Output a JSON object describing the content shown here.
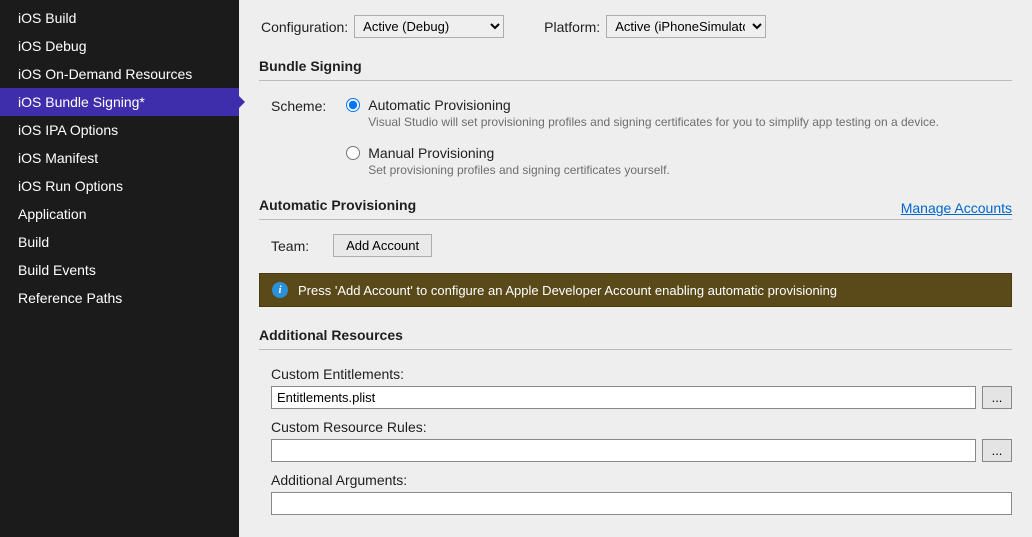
{
  "sidebar": {
    "items": [
      {
        "label": "iOS Build"
      },
      {
        "label": "iOS Debug"
      },
      {
        "label": "iOS On-Demand Resources"
      },
      {
        "label": "iOS Bundle Signing*"
      },
      {
        "label": "iOS IPA Options"
      },
      {
        "label": "iOS Manifest"
      },
      {
        "label": "iOS Run Options"
      },
      {
        "label": "Application"
      },
      {
        "label": "Build"
      },
      {
        "label": "Build Events"
      },
      {
        "label": "Reference Paths"
      }
    ],
    "selected_index": 3
  },
  "top": {
    "configuration_label": "Configuration:",
    "configuration_value": "Active (Debug)",
    "platform_label": "Platform:",
    "platform_value": "Active (iPhoneSimulator)"
  },
  "bundle_signing": {
    "header": "Bundle Signing",
    "scheme_label": "Scheme:",
    "automatic": {
      "label": "Automatic Provisioning",
      "desc": "Visual Studio will set provisioning profiles and signing certificates for you to simplify app testing on a device."
    },
    "manual": {
      "label": "Manual Provisioning",
      "desc": "Set provisioning profiles and signing certificates yourself."
    },
    "selected_scheme": "automatic"
  },
  "auto_provisioning": {
    "header": "Automatic Provisioning",
    "manage_link": "Manage Accounts",
    "team_label": "Team:",
    "add_account_btn": "Add Account",
    "info_msg": "Press 'Add Account' to configure an Apple Developer Account enabling automatic provisioning"
  },
  "additional": {
    "header": "Additional Resources",
    "entitlements_label": "Custom Entitlements:",
    "entitlements_value": "Entitlements.plist",
    "resource_rules_label": "Custom Resource Rules:",
    "resource_rules_value": "",
    "arguments_label": "Additional Arguments:",
    "arguments_value": "",
    "browse": "..."
  }
}
